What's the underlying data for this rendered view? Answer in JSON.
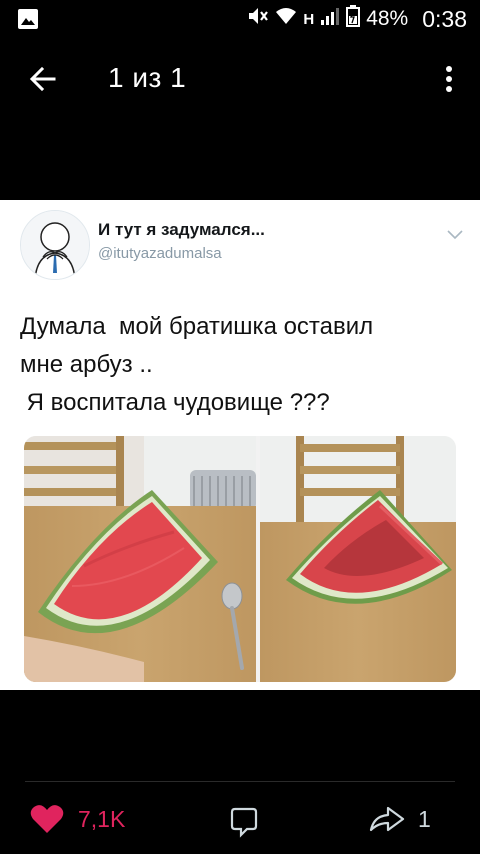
{
  "status_bar": {
    "network": "H",
    "battery": "48%",
    "time": "0:38",
    "icons": [
      "gallery-icon",
      "mute-icon",
      "wifi-icon",
      "signal-icon",
      "battery-icon"
    ]
  },
  "viewer": {
    "title": "1 из 1",
    "icons": [
      "arrow-left-icon",
      "more-vertical-icon"
    ]
  },
  "tweet": {
    "author_name": "И тут я задумался...",
    "author_handle": "@itutyazadumalsa",
    "text_lines": [
      "Думала  мой братишка оставил",
      "мне арбуз ..",
      " Я воспитала чудовище ???"
    ],
    "media": [
      "watermelon-slice-photo",
      "hollowed-watermelon-photo"
    ]
  },
  "actions": {
    "like_count": "7,1K",
    "share_count": "1",
    "colors": {
      "like": "#e0245e",
      "icon": "#cfd9de"
    }
  }
}
